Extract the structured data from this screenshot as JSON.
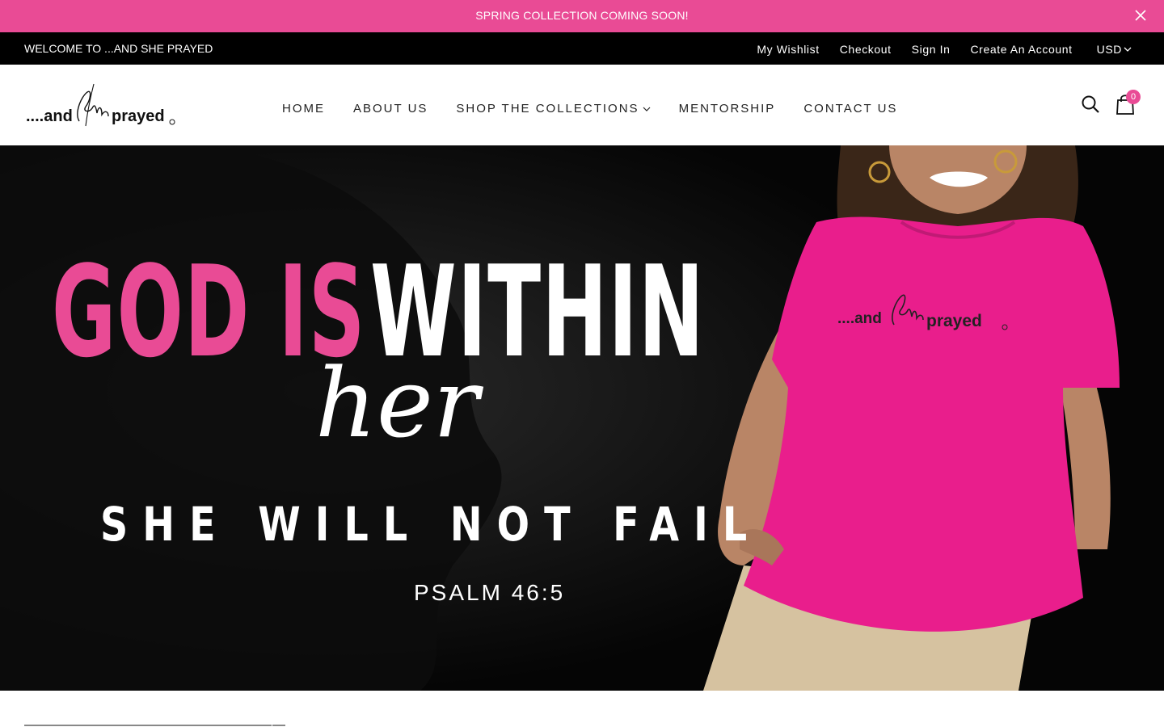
{
  "announcement": {
    "text": "SPRING COLLECTION COMING SOON!"
  },
  "topbar": {
    "welcome": "WELCOME TO ...AND SHE PRAYED",
    "links": [
      "My Wishlist",
      "Checkout",
      "Sign In",
      "Create An Account"
    ],
    "currency": "USD"
  },
  "nav": {
    "items": [
      "HOME",
      "ABOUT US",
      "SHOP THE COLLECTIONS",
      "MENTORSHIP",
      "CONTACT US"
    ]
  },
  "cart": {
    "count": "0"
  },
  "hero": {
    "line1_pink": "GOD IS",
    "line1_white": "WITHIN",
    "script": "her",
    "line2": "SHE WILL NOT FAIL",
    "verse": "PSALM 46:5"
  },
  "colors": {
    "accent": "#e94b95",
    "topbar": "#000000"
  },
  "icons": [
    "close-icon",
    "chevron-down-icon",
    "search-icon",
    "bag-icon"
  ]
}
